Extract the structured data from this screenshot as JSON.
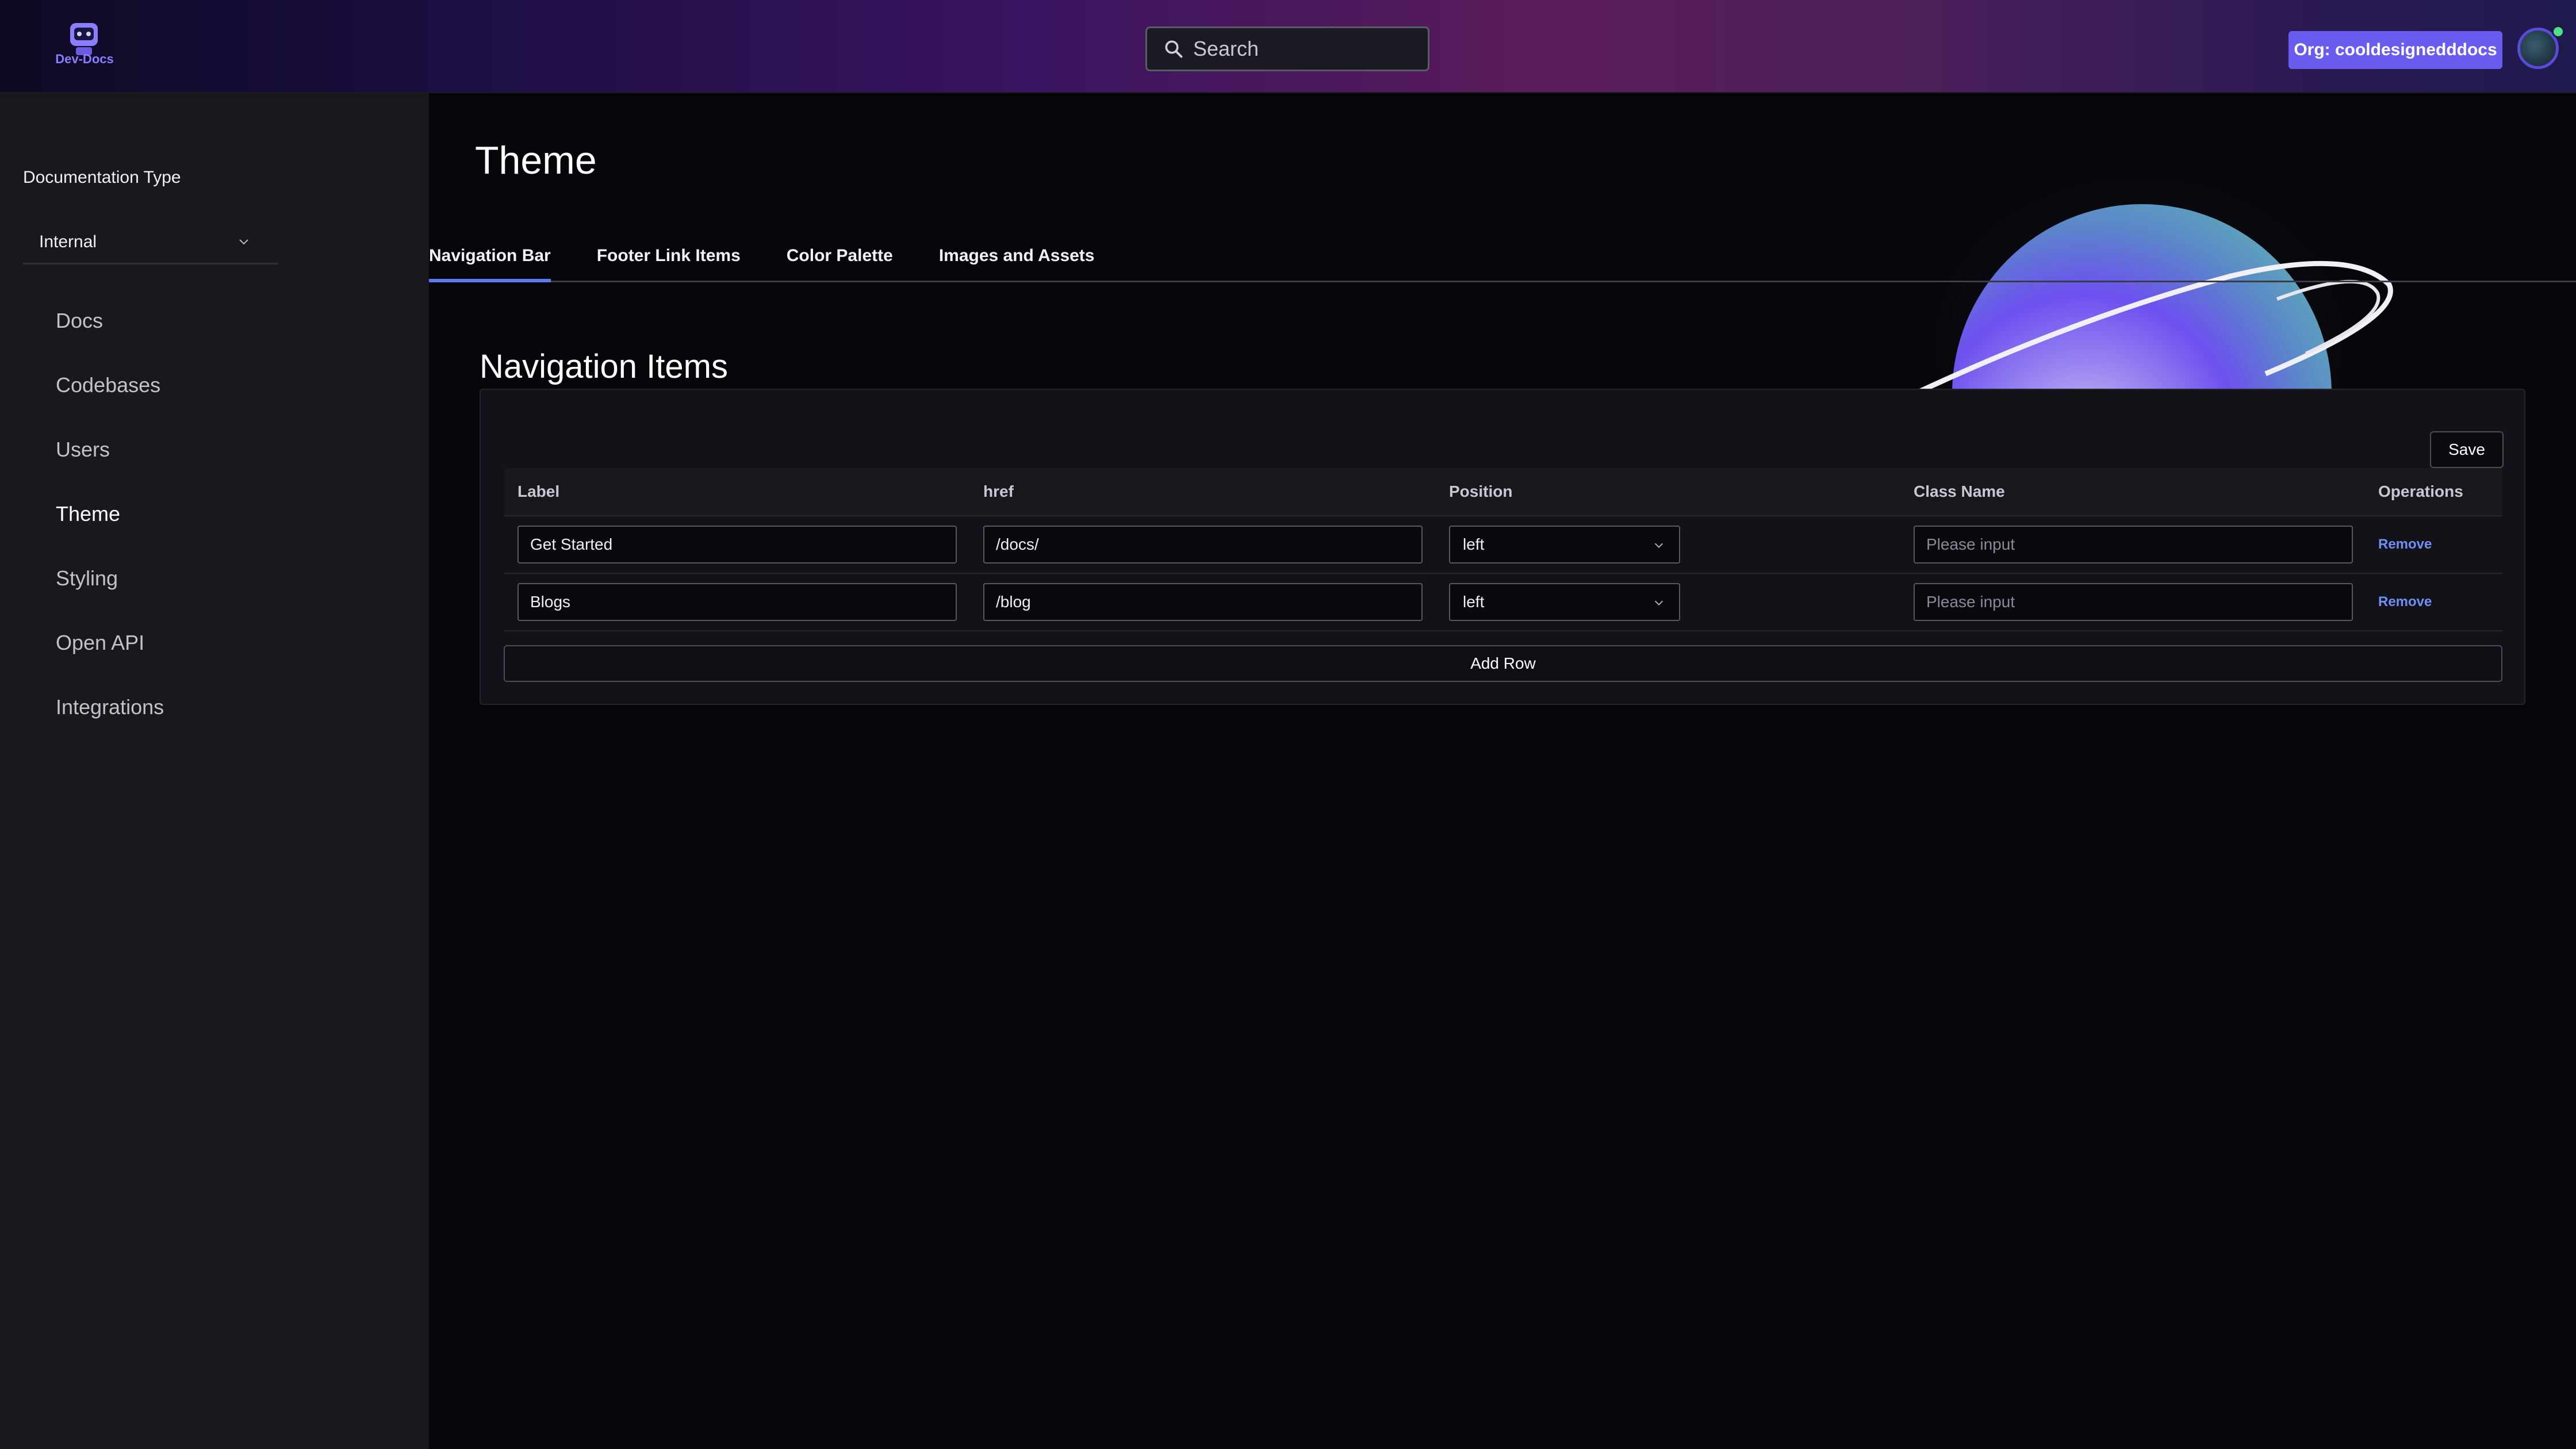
{
  "app": {
    "logo_text": "Dev-Docs",
    "search_placeholder": "Search",
    "org_button": "Org: cooldesignedddocs",
    "accent_color": "#6b5cf0"
  },
  "sidebar": {
    "doc_type_label": "Documentation Type",
    "doc_type_value": "Internal",
    "items": [
      {
        "label": "Docs"
      },
      {
        "label": "Codebases"
      },
      {
        "label": "Users"
      },
      {
        "label": "Theme"
      },
      {
        "label": "Styling"
      },
      {
        "label": "Open API"
      },
      {
        "label": "Integrations"
      }
    ]
  },
  "main": {
    "title": "Theme",
    "tabs": [
      {
        "label": "Navigation Bar"
      },
      {
        "label": "Footer Link Items"
      },
      {
        "label": "Color Palette"
      },
      {
        "label": "Images and Assets"
      }
    ],
    "section_title": "Navigation Items",
    "save_label": "Save",
    "columns": [
      "Label",
      "href",
      "Position",
      "Class Name",
      "Operations"
    ],
    "rows": [
      {
        "label": "Get Started",
        "href": "/docs/",
        "position": "left",
        "class_name": "",
        "class_placeholder": "Please input",
        "op": "Remove"
      },
      {
        "label": "Blogs",
        "href": "/blog",
        "position": "left",
        "class_name": "",
        "class_placeholder": "Please input",
        "op": "Remove"
      }
    ],
    "add_row_label": "Add Row"
  }
}
